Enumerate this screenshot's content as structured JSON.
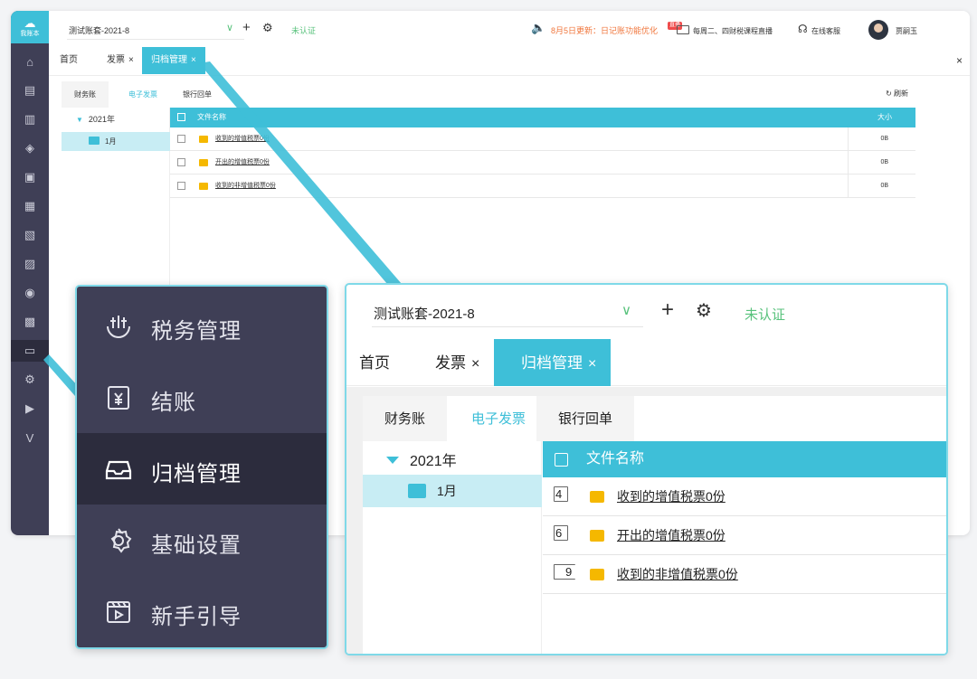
{
  "app": {
    "logo_text": "我账本",
    "account": "测试账套-2021-8",
    "uncertified": "未认证",
    "update_notice": "8月5日更新：日记账功能优化",
    "live_badge": "直播",
    "live_text": "每周二、四财税课程直播",
    "service": "在线客服",
    "user": "贾嗣玉"
  },
  "tabs": [
    {
      "label": "首页"
    },
    {
      "label": "发票",
      "close": "×"
    },
    {
      "label": "归档管理",
      "close": "×"
    }
  ],
  "window_close": "×",
  "archive": {
    "subtabs": [
      "财务账",
      "电子发票",
      "银行回单"
    ],
    "refresh": "刷新",
    "tree": {
      "year": "2021年",
      "month": "1月"
    },
    "table": {
      "headers": {
        "name": "文件名称",
        "size": "大小"
      },
      "rows": [
        {
          "marker": "4",
          "name": "收到的增值税票0份",
          "size": "0B"
        },
        {
          "marker": "6",
          "name": "开出的增值税票0份",
          "size": "0B"
        },
        {
          "marker": "9",
          "name": "收到的非增值税票0份",
          "size": "0B"
        }
      ]
    }
  },
  "zoom_menu": {
    "items": [
      {
        "label": "税务管理",
        "icon": "tax-icon"
      },
      {
        "label": "结账",
        "icon": "checkout-icon"
      },
      {
        "label": "归档管理",
        "icon": "archive-tray-icon",
        "active": true
      },
      {
        "label": "基础设置",
        "icon": "gear-icon"
      },
      {
        "label": "新手引导",
        "icon": "video-guide-icon"
      }
    ]
  },
  "colors": {
    "accent": "#3ebfd8",
    "sidebar": "#3f3f56",
    "sidebar_active": "#2c2c3d",
    "green": "#58c27c",
    "orange": "#f0763c",
    "folder": "#f5b800"
  }
}
